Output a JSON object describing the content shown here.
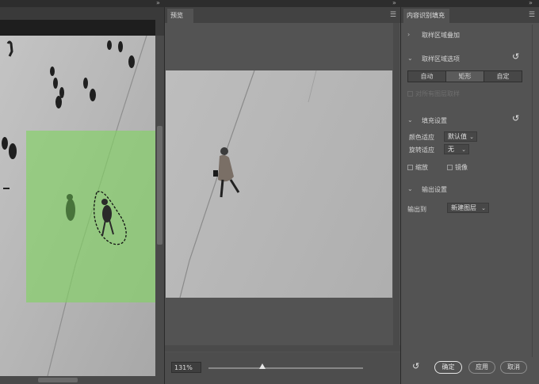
{
  "preview": {
    "tab_label": "预览",
    "zoom_value": "131%",
    "zoom_slider_position": 0.35
  },
  "panel": {
    "title": "内容识别填充",
    "sampling_overlay": {
      "label": "取样区域叠加"
    },
    "sampling_options": {
      "label": "取样区域选项",
      "modes": [
        "自动",
        "矩形",
        "自定"
      ],
      "active_mode": "矩形",
      "sample_all_layers": "对所有图层取样"
    },
    "fill_settings": {
      "label": "填充设置",
      "color_adapt_label": "颜色适应",
      "color_adapt_value": "默认值",
      "rotation_adapt_label": "旋转适应",
      "rotation_adapt_value": "无",
      "scale_label": "缩放",
      "mirror_label": "镜像"
    },
    "output_settings": {
      "label": "输出设置",
      "output_to_label": "输出到",
      "output_to_value": "新建图层"
    },
    "buttons": {
      "ok": "确定",
      "apply": "应用",
      "cancel": "取消"
    }
  },
  "colors": {
    "sampling_overlay": "#82d264",
    "panel_bg": "#535353",
    "canvas_bg": "#3a3a3a"
  }
}
